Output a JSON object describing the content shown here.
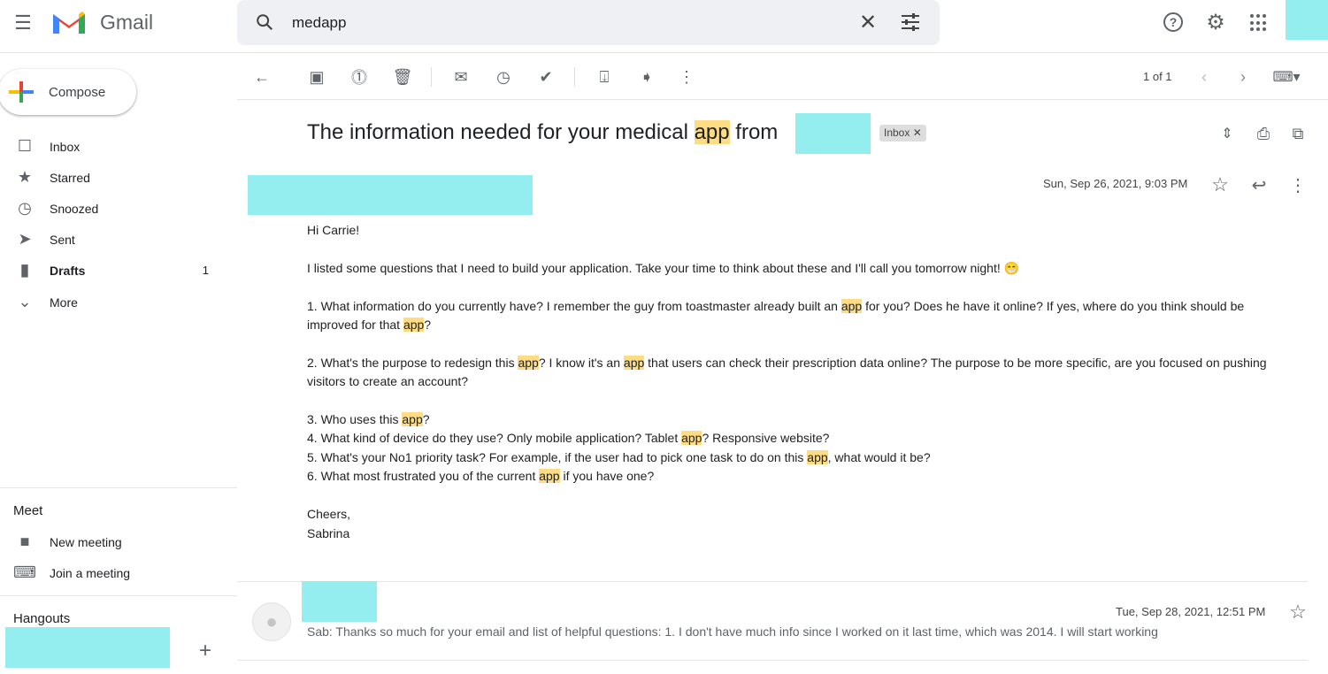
{
  "header": {
    "app_name": "Gmail",
    "search_value": "medapp"
  },
  "compose_label": "Compose",
  "sidebar": {
    "items": [
      {
        "label": "Inbox",
        "icon": "inbox-icon"
      },
      {
        "label": "Starred",
        "icon": "star-icon"
      },
      {
        "label": "Snoozed",
        "icon": "clock-icon"
      },
      {
        "label": "Sent",
        "icon": "send-icon"
      },
      {
        "label": "Drafts",
        "icon": "draft-icon",
        "count": "1"
      },
      {
        "label": "More",
        "icon": "chevron-down-icon"
      }
    ],
    "meet_title": "Meet",
    "meet_items": [
      {
        "label": "New meeting"
      },
      {
        "label": "Join a meeting"
      }
    ],
    "hangouts_title": "Hangouts"
  },
  "toolbar": {
    "pagination": "1 of 1"
  },
  "email": {
    "subject_pre": "The information needed for your medical ",
    "subject_hl": "app",
    "subject_post": " from",
    "label": "Inbox",
    "date": "Sun, Sep 26, 2021, 9:03 PM",
    "body": [
      [
        {
          "t": "Hi Carrie!"
        }
      ],
      [
        {
          "t": "I listed some questions that I need to build your application. Take your time to think about these and I'll call you tomorrow night! 😁"
        }
      ],
      [
        {
          "t": "1. What information do you currently have? I remember the guy from toastmaster already built an "
        },
        {
          "t": "app",
          "hl": 1
        },
        {
          "t": " for you? Does he have it online? If yes, where do you think should be"
        }
      ],
      [
        {
          "t": "improved for that "
        },
        {
          "t": "app",
          "hl": 1
        },
        {
          "t": "?"
        }
      ],
      [
        {
          "t": "2. What's the purpose to redesign this "
        },
        {
          "t": "app",
          "hl": 1
        },
        {
          "t": "? I know it's an "
        },
        {
          "t": "app",
          "hl": 1
        },
        {
          "t": " that users can check their prescription data online? The purpose to be more specific, are you focused on pushing"
        }
      ],
      [
        {
          "t": "visitors to create an account?"
        }
      ],
      [
        {
          "t": "3. Who uses this "
        },
        {
          "t": "app",
          "hl": 1
        },
        {
          "t": "?"
        }
      ],
      [
        {
          "t": "4. What kind of device do they use? Only mobile application? Tablet "
        },
        {
          "t": "app",
          "hl": 1
        },
        {
          "t": "? Responsive website?"
        }
      ],
      [
        {
          "t": "5. What's your No1 priority task? For example, if the user had to pick one task to do on this "
        },
        {
          "t": "app",
          "hl": 1
        },
        {
          "t": ", what would it be?"
        }
      ],
      [
        {
          "t": "6. What most frustrated you of the current "
        },
        {
          "t": "app",
          "hl": 1
        },
        {
          "t": " if you have one?"
        }
      ],
      [
        {
          "t": "Cheers,"
        }
      ],
      [
        {
          "t": "Sabrina"
        }
      ]
    ]
  },
  "reply": {
    "date": "Tue, Sep 28, 2021, 12:51 PM",
    "snippet": "Sab: Thanks so much for your email and list of helpful questions: 1. I don't have much info since I worked on it last time, which was 2014. I will start working"
  }
}
